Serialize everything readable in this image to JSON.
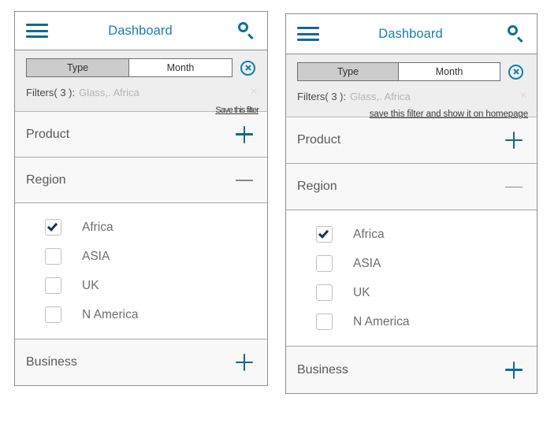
{
  "panels": [
    {
      "id": "left",
      "appbar": {
        "menu_icon": "hamburger-icon",
        "title": "Dashboard",
        "search_icon": "search-icon"
      },
      "filterbar": {
        "segments": [
          {
            "label": "Type",
            "selected": true
          },
          {
            "label": "Month",
            "selected": false
          }
        ],
        "clear_icon": "circle-x-icon",
        "filters_label": "Filters( 3 ):",
        "filters_values": "Glass,. Africa",
        "dismiss_icon": "close-x-icon",
        "dismiss_glyph": "×",
        "save_link": "Save this filter"
      },
      "sections": [
        {
          "title": "Product",
          "state": "collapsed",
          "toggle_icon": "plus-icon"
        },
        {
          "title": "Region",
          "state": "expanded",
          "toggle_icon": "minus-icon"
        },
        {
          "title": "Business",
          "state": "collapsed",
          "toggle_icon": "plus-icon"
        }
      ],
      "region_options": [
        {
          "label": "Africa",
          "checked": true
        },
        {
          "label": "ASIA",
          "checked": false
        },
        {
          "label": "UK",
          "checked": false
        },
        {
          "label": "N America",
          "checked": false
        }
      ]
    },
    {
      "id": "right",
      "appbar": {
        "menu_icon": "hamburger-icon",
        "title": "Dashboard",
        "search_icon": "search-icon"
      },
      "filterbar": {
        "segments": [
          {
            "label": "Type",
            "selected": true
          },
          {
            "label": "Month",
            "selected": false
          }
        ],
        "clear_icon": "circle-x-icon",
        "filters_label": "Filters( 3 ):",
        "filters_values": "Glass,. Africa",
        "dismiss_icon": "close-x-icon",
        "dismiss_glyph": "×",
        "save_link": "save this filter and show it on homepage"
      },
      "sections": [
        {
          "title": "Product",
          "state": "collapsed",
          "toggle_icon": "plus-icon"
        },
        {
          "title": "Region",
          "state": "expanded",
          "toggle_icon": "minus-icon"
        },
        {
          "title": "Business",
          "state": "collapsed",
          "toggle_icon": "plus-icon"
        }
      ],
      "region_options": [
        {
          "label": "Africa",
          "checked": true
        },
        {
          "label": "ASIA",
          "checked": false
        },
        {
          "label": "UK",
          "checked": false
        },
        {
          "label": "N America",
          "checked": false
        }
      ]
    }
  ],
  "colors": {
    "accent": "#13698f",
    "title": "#1b7fa8",
    "segment_selected_bg": "#cccccc",
    "filterbar_bg": "#eeeeee",
    "section_header_bg": "#f8f8f8",
    "checkmark": "#16355e",
    "border": "#8f8f8f",
    "muted_text": "#b4b4b4"
  }
}
